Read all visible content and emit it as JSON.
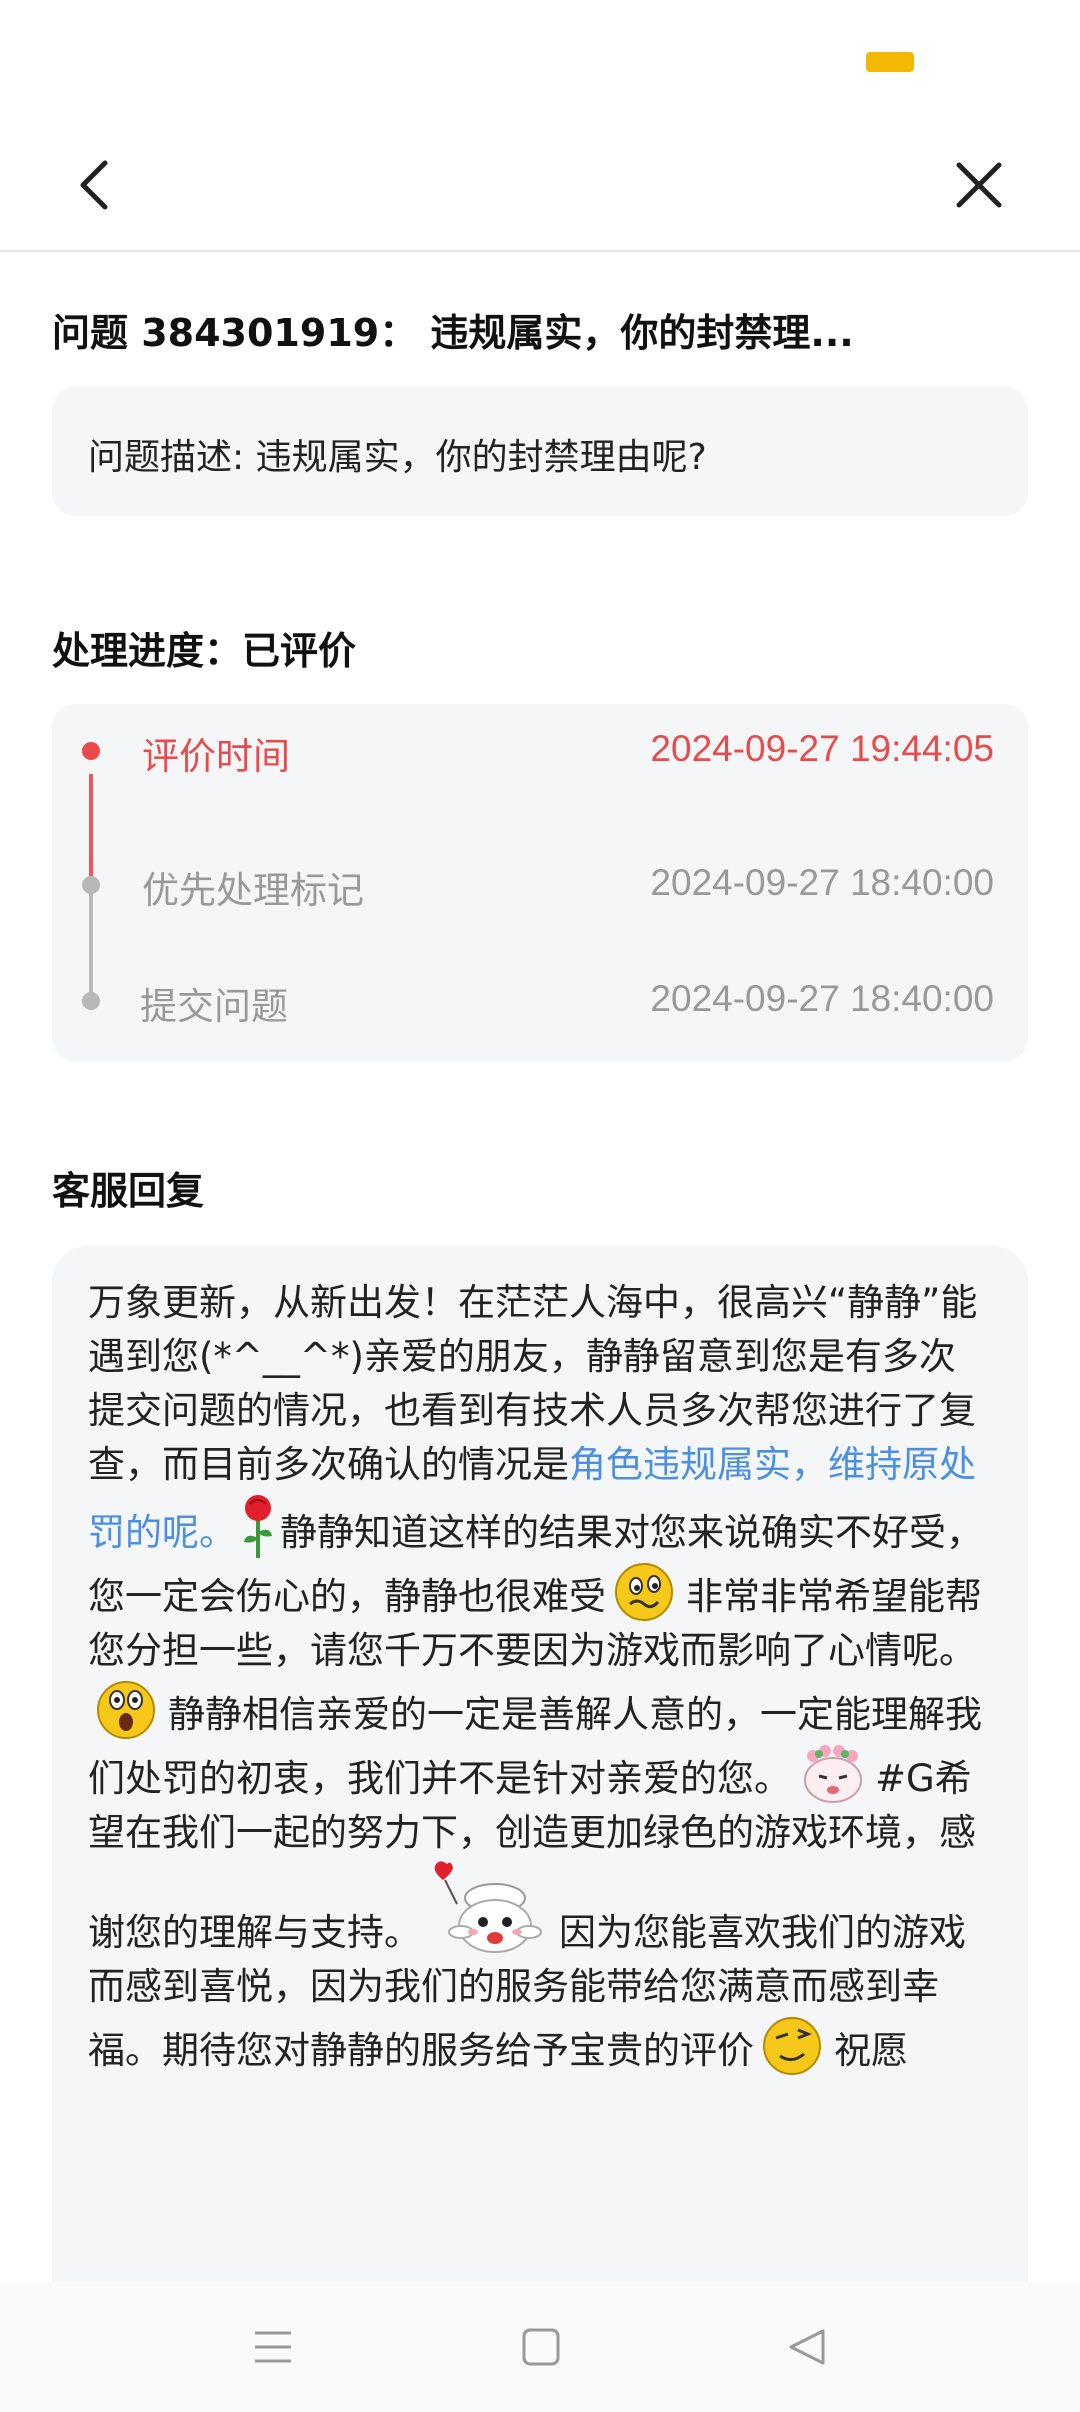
{
  "status": {
    "accent_color": "#f5b800"
  },
  "nav": {
    "back_icon": "chevron-left-icon",
    "close_icon": "close-icon"
  },
  "question": {
    "title": "问题 384301919： 违规属实，你的封禁理...",
    "description": "问题描述: 违规属实，你的封禁理由呢?"
  },
  "progress": {
    "title": "处理进度：已评价",
    "timeline": [
      {
        "label": "评价时间",
        "time": "2024-09-27 19:44:05",
        "active": true
      },
      {
        "label": "优先处理标记",
        "time": "2024-09-27 18:40:00",
        "active": false
      },
      {
        "label": "提交问题",
        "time": "2024-09-27 18:40:00",
        "active": false
      }
    ]
  },
  "reply": {
    "title": "客服回复",
    "segments": {
      "s1": "万象更新，从新出发！在茫茫人海中，很高兴“静静”能遇到您(*^__^*)亲爱的朋友，静静留意到您是有多次提交问题的情况，也看到有技术人员多次帮您进行了复查，而目前多次确认的情况是",
      "s2_highlight": "角色违规属实，维持原处罚的呢。",
      "s3": "静静知道这样的结果对您来说确实不好受，您一定会伤心的，静静也很难受",
      "s4": "非常非常希望能帮您分担一些，请您千万不要因为游戏而影响了心情呢。",
      "s5": "静静相信亲爱的一定是善解人意的，一定能理解我们处罚的初衷，我们并不是针对亲爱的您。",
      "s6": "#G希望在我们一起的努力下，创造更加绿色的游戏环境，感谢您的理解与支持。",
      "s7": "因为您能喜欢我们的游戏而感到喜悦，因为我们的服务能带给您满意而感到幸福。期待您对静静的服务给予宝贵的评价",
      "s8": "祝愿"
    },
    "highlight_color": "#4b8fe0"
  },
  "colors": {
    "active": "#e84b4b",
    "inactive": "#999999",
    "panel": "#f5f6f8"
  },
  "bottom_nav": {
    "menu_icon": "menu-icon",
    "home_icon": "home-square-icon",
    "back_icon": "back-triangle-icon"
  }
}
